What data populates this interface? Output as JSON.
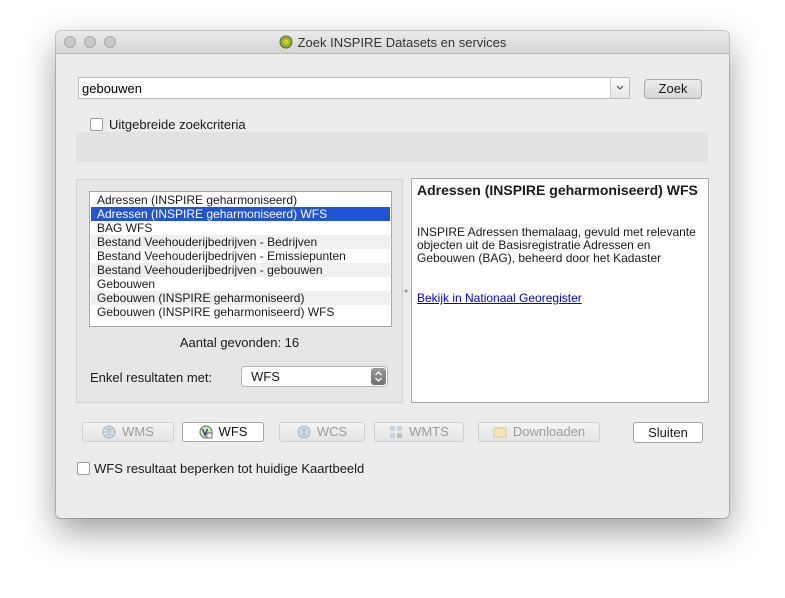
{
  "window": {
    "title": "Zoek INSPIRE Datasets en services"
  },
  "search": {
    "value": "gebouwen",
    "button": "Zoek"
  },
  "advanced": {
    "label": "Uitgebreide zoekcriteria",
    "checked": false
  },
  "results": {
    "items": [
      "Adressen (INSPIRE geharmoniseerd)",
      "Adressen (INSPIRE geharmoniseerd) WFS",
      "BAG WFS",
      "Bestand Veehouderijbedrijven - Bedrijven",
      "Bestand Veehouderijbedrijven - Emissiepunten",
      "Bestand Veehouderijbedrijven - gebouwen",
      "Gebouwen",
      "Gebouwen (INSPIRE geharmoniseerd)",
      "Gebouwen (INSPIRE geharmoniseerd) WFS"
    ],
    "selected_index": 1,
    "count_text": "Aantal gevonden: 16"
  },
  "filter": {
    "label": "Enkel resultaten met:",
    "value": "WFS"
  },
  "details": {
    "title": "Adressen (INSPIRE geharmoniseerd) WFS",
    "description": "INSPIRE Adressen themalaag, gevuld met relevante objecten uit de Basisregistratie Adressen en Gebouwen (BAG), beheerd door het Kadaster",
    "link": "Bekijk in Nationaal Georegister"
  },
  "services": {
    "wms": "WMS",
    "wfs": "WFS",
    "wcs": "WCS",
    "wmts": "WMTS",
    "download": "Downloaden",
    "close": "Sluiten"
  },
  "limit": {
    "label": "WFS resultaat beperken tot huidige Kaartbeeld",
    "checked": false
  },
  "colors": {
    "selection": "#1f55d6",
    "link": "#0000ee",
    "window_bg": "#ececec"
  },
  "icons": {
    "app": "qgis-icon",
    "globe": "globe-icon",
    "wfs": "wfs-layer-icon",
    "wmts": "tiles-icon",
    "download": "download-icon"
  }
}
